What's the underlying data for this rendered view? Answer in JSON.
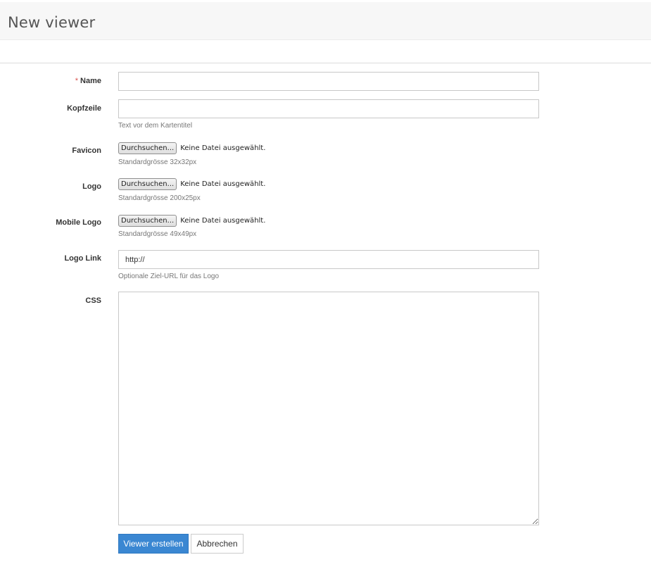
{
  "header": {
    "title": "New viewer"
  },
  "form": {
    "name": {
      "label": "Name",
      "required_mark": "*",
      "value": ""
    },
    "kopfzeile": {
      "label": "Kopfzeile",
      "value": "",
      "help": "Text vor dem Kartentitel"
    },
    "favicon": {
      "label": "Favicon",
      "button": "Durchsuchen...",
      "status": "Keine Datei ausgewählt.",
      "help": "Standardgrösse 32x32px"
    },
    "logo": {
      "label": "Logo",
      "button": "Durchsuchen...",
      "status": "Keine Datei ausgewählt.",
      "help": "Standardgrösse 200x25px"
    },
    "mobile_logo": {
      "label": "Mobile Logo",
      "button": "Durchsuchen...",
      "status": "Keine Datei ausgewählt.",
      "help": "Standardgrösse 49x49px"
    },
    "logo_link": {
      "label": "Logo Link",
      "value": "http://",
      "help": "Optionale Ziel-URL für das Logo"
    },
    "css": {
      "label": "CSS",
      "value": ""
    }
  },
  "actions": {
    "submit_label": "Viewer erstellen",
    "cancel_label": "Abbrechen"
  },
  "colors": {
    "primary": "#3a87d2",
    "required": "#d9534f"
  }
}
